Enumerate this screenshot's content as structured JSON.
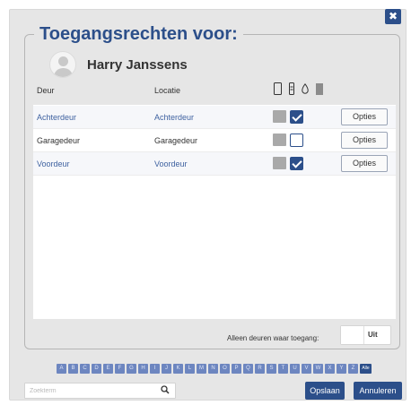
{
  "dialog": {
    "title": "Toegangsrechten voor:",
    "close_icon": "close-icon",
    "user": {
      "name": "Harry Janssens",
      "avatar_icon": "user-avatar-icon"
    }
  },
  "table": {
    "headers": {
      "door": "Deur",
      "location": "Locatie"
    },
    "device_icons": [
      "smartphone-icon",
      "key-fob-icon",
      "tag-icon",
      "barcode-icon"
    ],
    "rows": [
      {
        "door": "Achterdeur",
        "location": "Achterdeur",
        "checked": true,
        "options_label": "Opties"
      },
      {
        "door": "Garagedeur",
        "location": "Garagedeur",
        "checked": false,
        "options_label": "Opties"
      },
      {
        "door": "Voordeur",
        "location": "Voordeur",
        "checked": true,
        "options_label": "Opties"
      }
    ]
  },
  "filter": {
    "label": "Alleen deuren waar toegang:",
    "toggle_value": "Uit"
  },
  "alphabet": [
    "A",
    "B",
    "C",
    "D",
    "E",
    "F",
    "G",
    "H",
    "I",
    "J",
    "K",
    "L",
    "M",
    "N",
    "O",
    "P",
    "Q",
    "R",
    "S",
    "T",
    "U",
    "V",
    "W",
    "X",
    "Y",
    "Z",
    "Alle"
  ],
  "search": {
    "placeholder": "Zoekterm",
    "icon": "search-icon"
  },
  "buttons": {
    "save": "Opslaan",
    "cancel": "Annuleren"
  },
  "colors": {
    "accent": "#2c4f8a",
    "link": "#3f62a0",
    "letter": "#6d86c0"
  }
}
